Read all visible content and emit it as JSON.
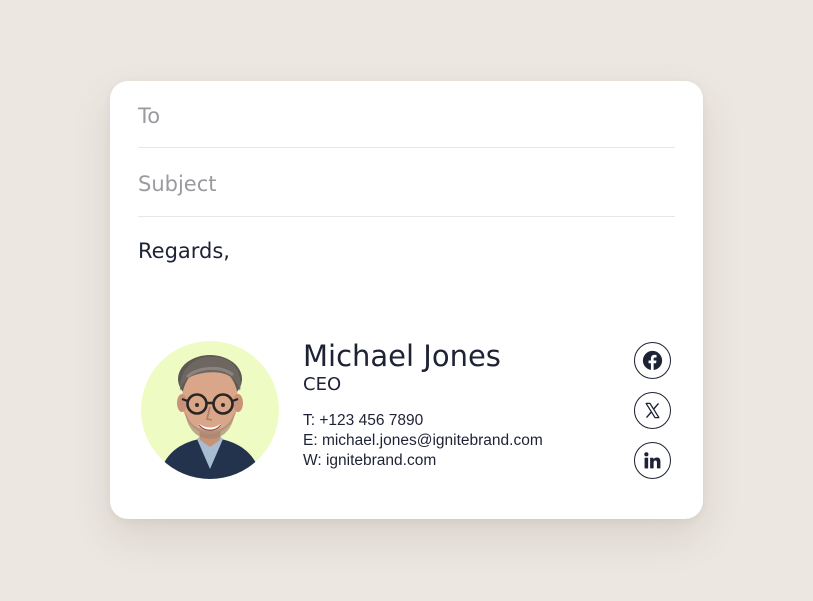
{
  "compose": {
    "to_placeholder": "To",
    "subject_placeholder": "Subject",
    "body_text": "Regards,"
  },
  "signature": {
    "name": "Michael Jones",
    "title": "CEO",
    "phone": "T: +123 456 7890",
    "email": "E: michael.jones@ignitebrand.com",
    "website": "W: ignitebrand.com",
    "avatar_background": "#eefcc4"
  },
  "social_links": [
    {
      "icon": "facebook-icon"
    },
    {
      "icon": "x-icon"
    },
    {
      "icon": "linkedin-icon"
    }
  ],
  "colors": {
    "page_background": "#ece7e1",
    "card_background": "#ffffff",
    "text": "#1e2235",
    "placeholder": "#9b9b9f"
  }
}
